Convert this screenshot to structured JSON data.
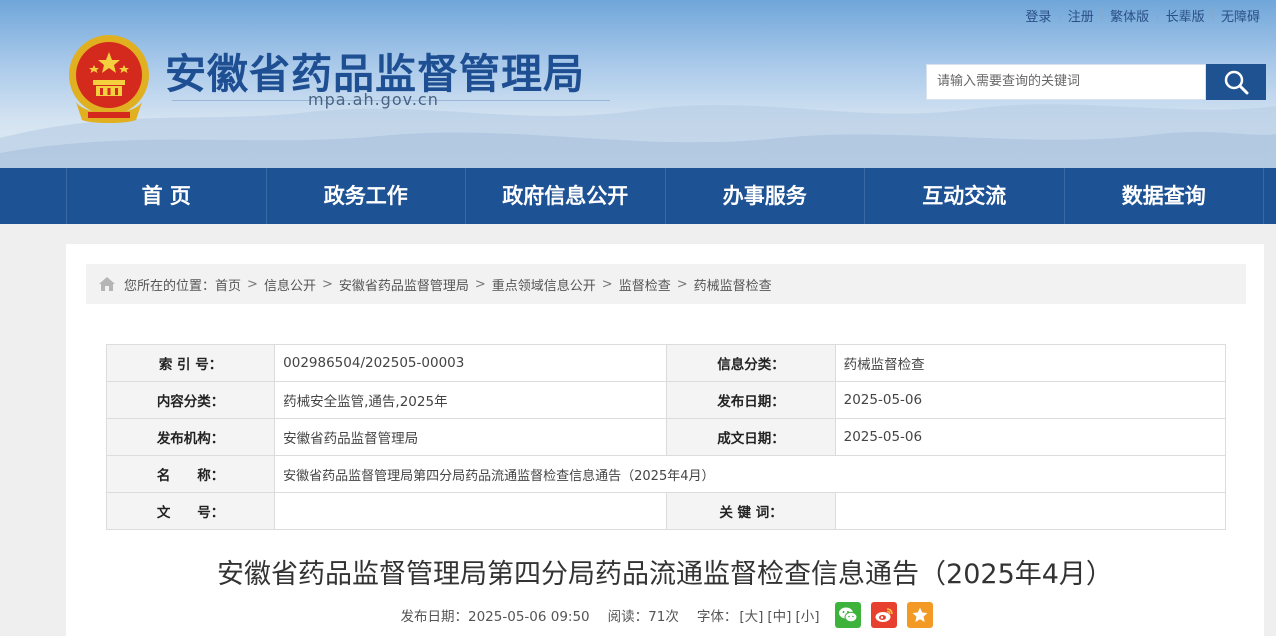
{
  "top_links": [
    "登录",
    "注册",
    "繁体版",
    "长辈版",
    "无障碍"
  ],
  "site": {
    "title": "安徽省药品监督管理局",
    "domain": "mpa.ah.gov.cn"
  },
  "search": {
    "placeholder": "请输入需要查询的关键词"
  },
  "nav": [
    "首 页",
    "政务工作",
    "政府信息公开",
    "办事服务",
    "互动交流",
    "数据查询"
  ],
  "breadcrumb": {
    "prefix": "您所在的位置：",
    "items": [
      "首页",
      "信息公开",
      "安徽省药品监督管理局",
      "重点领域信息公开",
      "监督检查",
      "药械监督检查"
    ]
  },
  "meta_table": {
    "index_label": "索 引 号：",
    "index_value": "002986504/202505-00003",
    "category_label": "信息分类：",
    "category_value": "药械监督检查",
    "content_label": "内容分类：",
    "content_value": "药械安全监管,通告,2025年",
    "publish_label": "发布日期：",
    "publish_value": "2025-05-06",
    "org_label": "发布机构：",
    "org_value": "安徽省药品监督管理局",
    "created_label": "成文日期：",
    "created_value": "2025-05-06",
    "name_label": "名　　称：",
    "name_value": "安徽省药品监督管理局第四分局药品流通监督检查信息通告（2025年4月）",
    "docno_label": "文　　号：",
    "docno_value": "",
    "keywords_label": "关 键 词：",
    "keywords_value": ""
  },
  "article": {
    "title": "安徽省药品监督管理局第四分局药品流通监督检查信息通告（2025年4月）",
    "publish_time": "发布日期：2025-05-06 09:50",
    "reads": "阅读：71次",
    "font_label": "字体：",
    "font_sizes": [
      "[大]",
      "[中]",
      "[小]"
    ]
  },
  "colors": {
    "nav_bg": "#1d5294",
    "title_blue": "#1f4f93",
    "wechat": "#3db33c",
    "weibo": "#e8402e",
    "favorite": "#f39a26"
  },
  "icons": [
    "search-icon",
    "home-icon",
    "wechat-icon",
    "weibo-icon",
    "star-icon"
  ]
}
